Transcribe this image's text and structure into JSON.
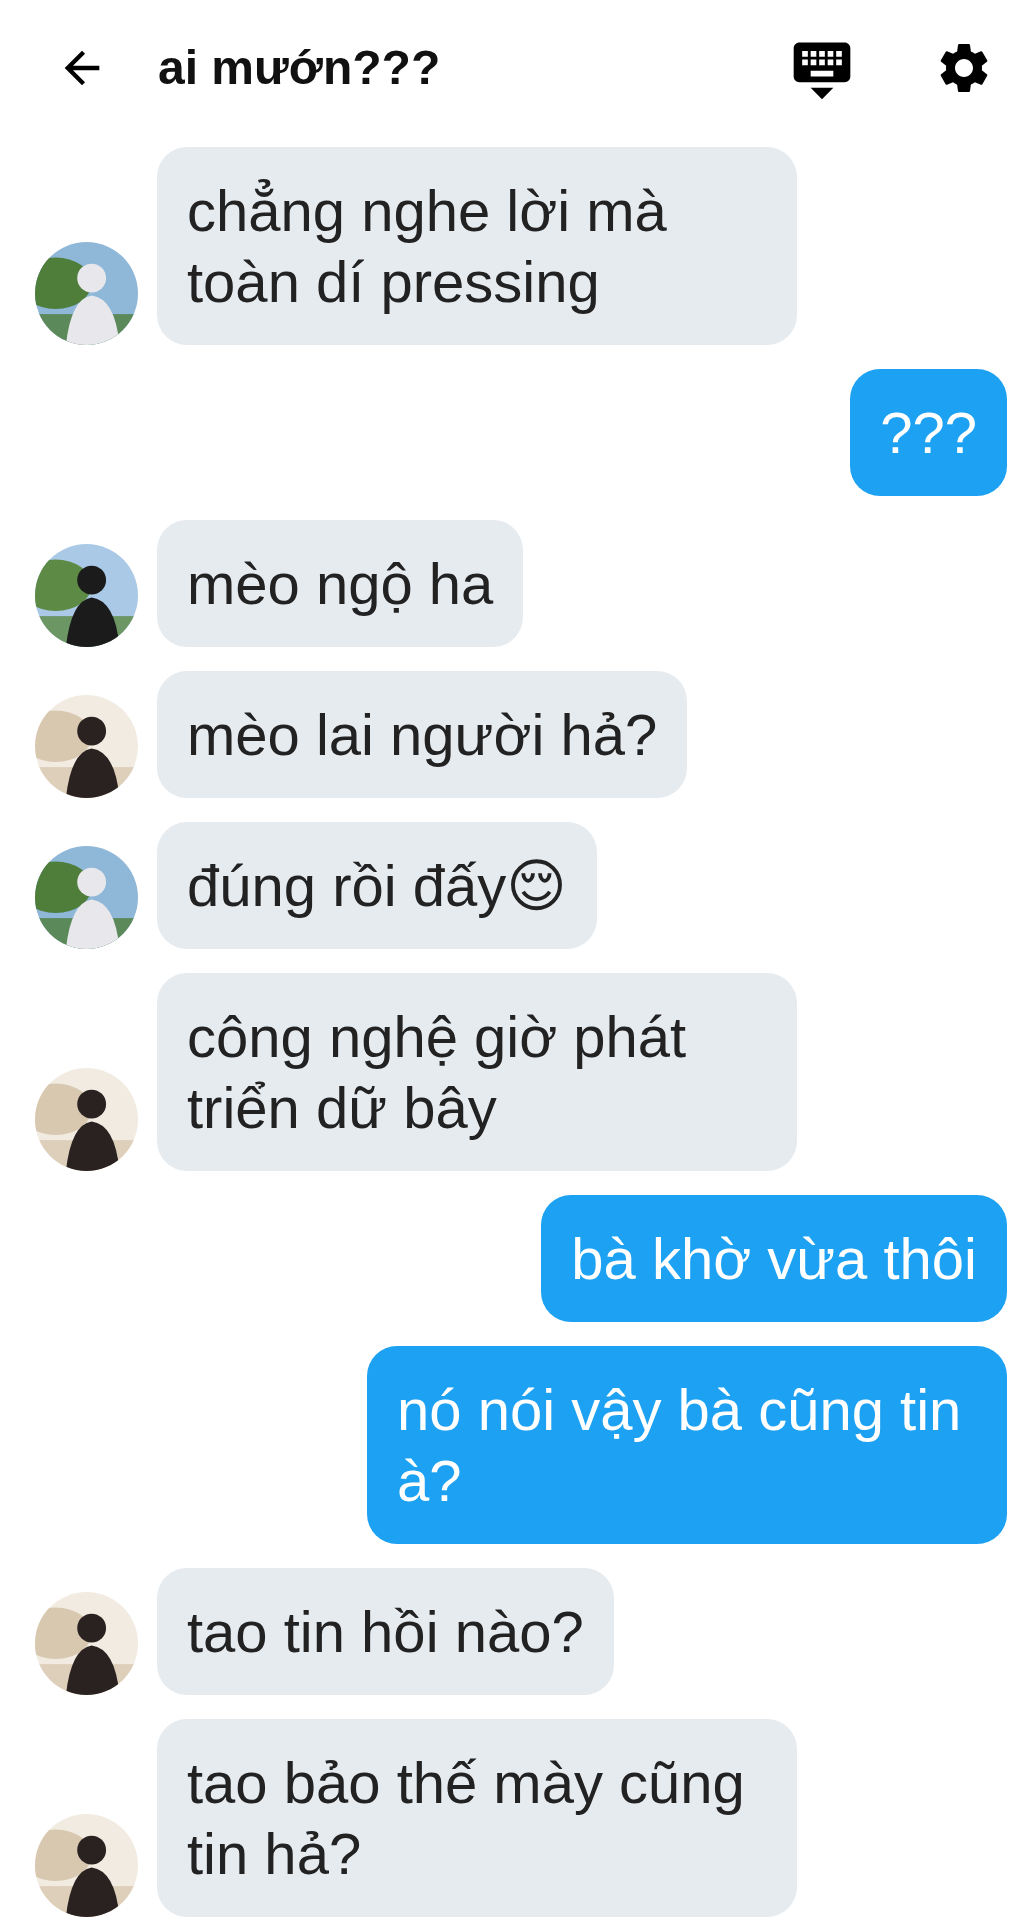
{
  "header": {
    "title": "ai mướn???"
  },
  "messages": [
    {
      "kind": "incoming",
      "text": "chẳng nghe lời mà toàn dí pressing"
    },
    {
      "kind": "outgoing",
      "text": "???"
    },
    {
      "kind": "incoming",
      "text": "mèo ngộ ha"
    },
    {
      "kind": "incoming",
      "text": "mèo lai người hả?"
    },
    {
      "kind": "incoming",
      "text": "đúng rồi đấy😌"
    },
    {
      "kind": "incoming",
      "text": "công nghệ giờ phát triển dữ bây"
    },
    {
      "kind": "outgoing",
      "text": "bà khờ vừa thôi"
    },
    {
      "kind": "outgoing",
      "text": "nó nói vậy bà cũng tin à?"
    },
    {
      "kind": "incoming",
      "text": "tao tin hồi nào?"
    },
    {
      "kind": "incoming",
      "text": "tao bảo thế mày cũng tin hả?"
    }
  ]
}
